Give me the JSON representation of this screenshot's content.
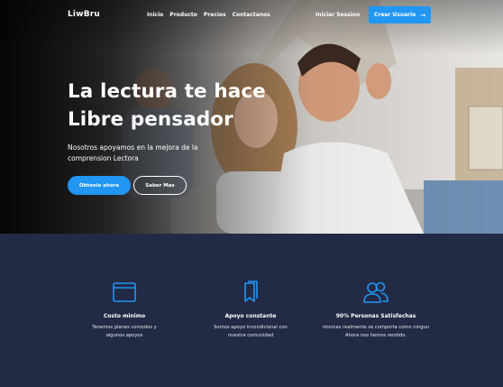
{
  "nav": {
    "logo": "LiwBru",
    "links": [
      "Inicio",
      "Producto",
      "Precios",
      "Contactanos"
    ],
    "login": "Iniciar Session",
    "signup": "Crear Usuario"
  },
  "hero": {
    "headline_line1": "La lectura te hace",
    "headline_line2": "Libre pensador",
    "subtext_line1": "Nosotros apoyamos en la mejora de la",
    "subtext_line2": "comprension Lectora",
    "primary_button": "Obtenio ahora",
    "secondary_button": "Saber Mas"
  },
  "features": [
    {
      "icon": "wallet-icon",
      "title": "Costo minimo",
      "desc_line1": "Tenemos planes comodos  y",
      "desc_line2": "algunos apoyos"
    },
    {
      "icon": "bookmark-icon",
      "title": "Apoyo constante",
      "desc_line1": "Somos apoyo incondicional con",
      "desc_line2": "nuestra comunidad"
    },
    {
      "icon": "users-icon",
      "title": "90% Personas Satisfechas",
      "desc_line1": "ntonces realmente se comporta como ningun",
      "desc_line2": "Ahora nos hemos rendido."
    }
  ],
  "colors": {
    "accent": "#2196f3",
    "dark_section": "#222a45"
  }
}
